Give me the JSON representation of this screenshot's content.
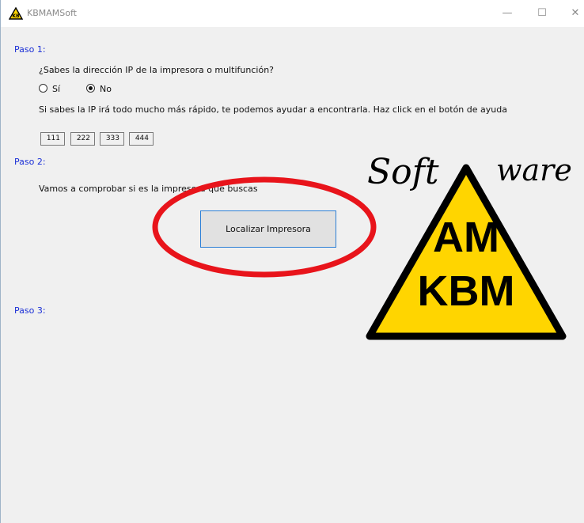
{
  "window": {
    "title": "KBMAMSoft"
  },
  "paso1": {
    "heading": "Paso 1:",
    "question": "¿Sabes la dirección IP de la impresora o multifunción?",
    "option_yes": "Sí",
    "option_no": "No",
    "selected": "No",
    "hint": "Si sabes la IP irá todo mucho más rápido, te podemos ayudar a encontrarla. Haz click en el botón de ayuda",
    "ip": [
      "111",
      "222",
      "333",
      "444"
    ]
  },
  "paso2": {
    "heading": "Paso 2:",
    "text": "Vamos a comprobar si es la impresora que buscas",
    "button": "Localizar Impresora"
  },
  "paso3": {
    "heading": "Paso 3:"
  },
  "logo": {
    "text_top_left": "Soft",
    "text_top_right": "ware",
    "line1": "AM",
    "line2": "KBM"
  },
  "colors": {
    "accent_text": "#1a2fd6",
    "annotation_circle": "#e8141b",
    "logo_yellow": "#ffd500",
    "button_border": "#2c7fd6"
  }
}
